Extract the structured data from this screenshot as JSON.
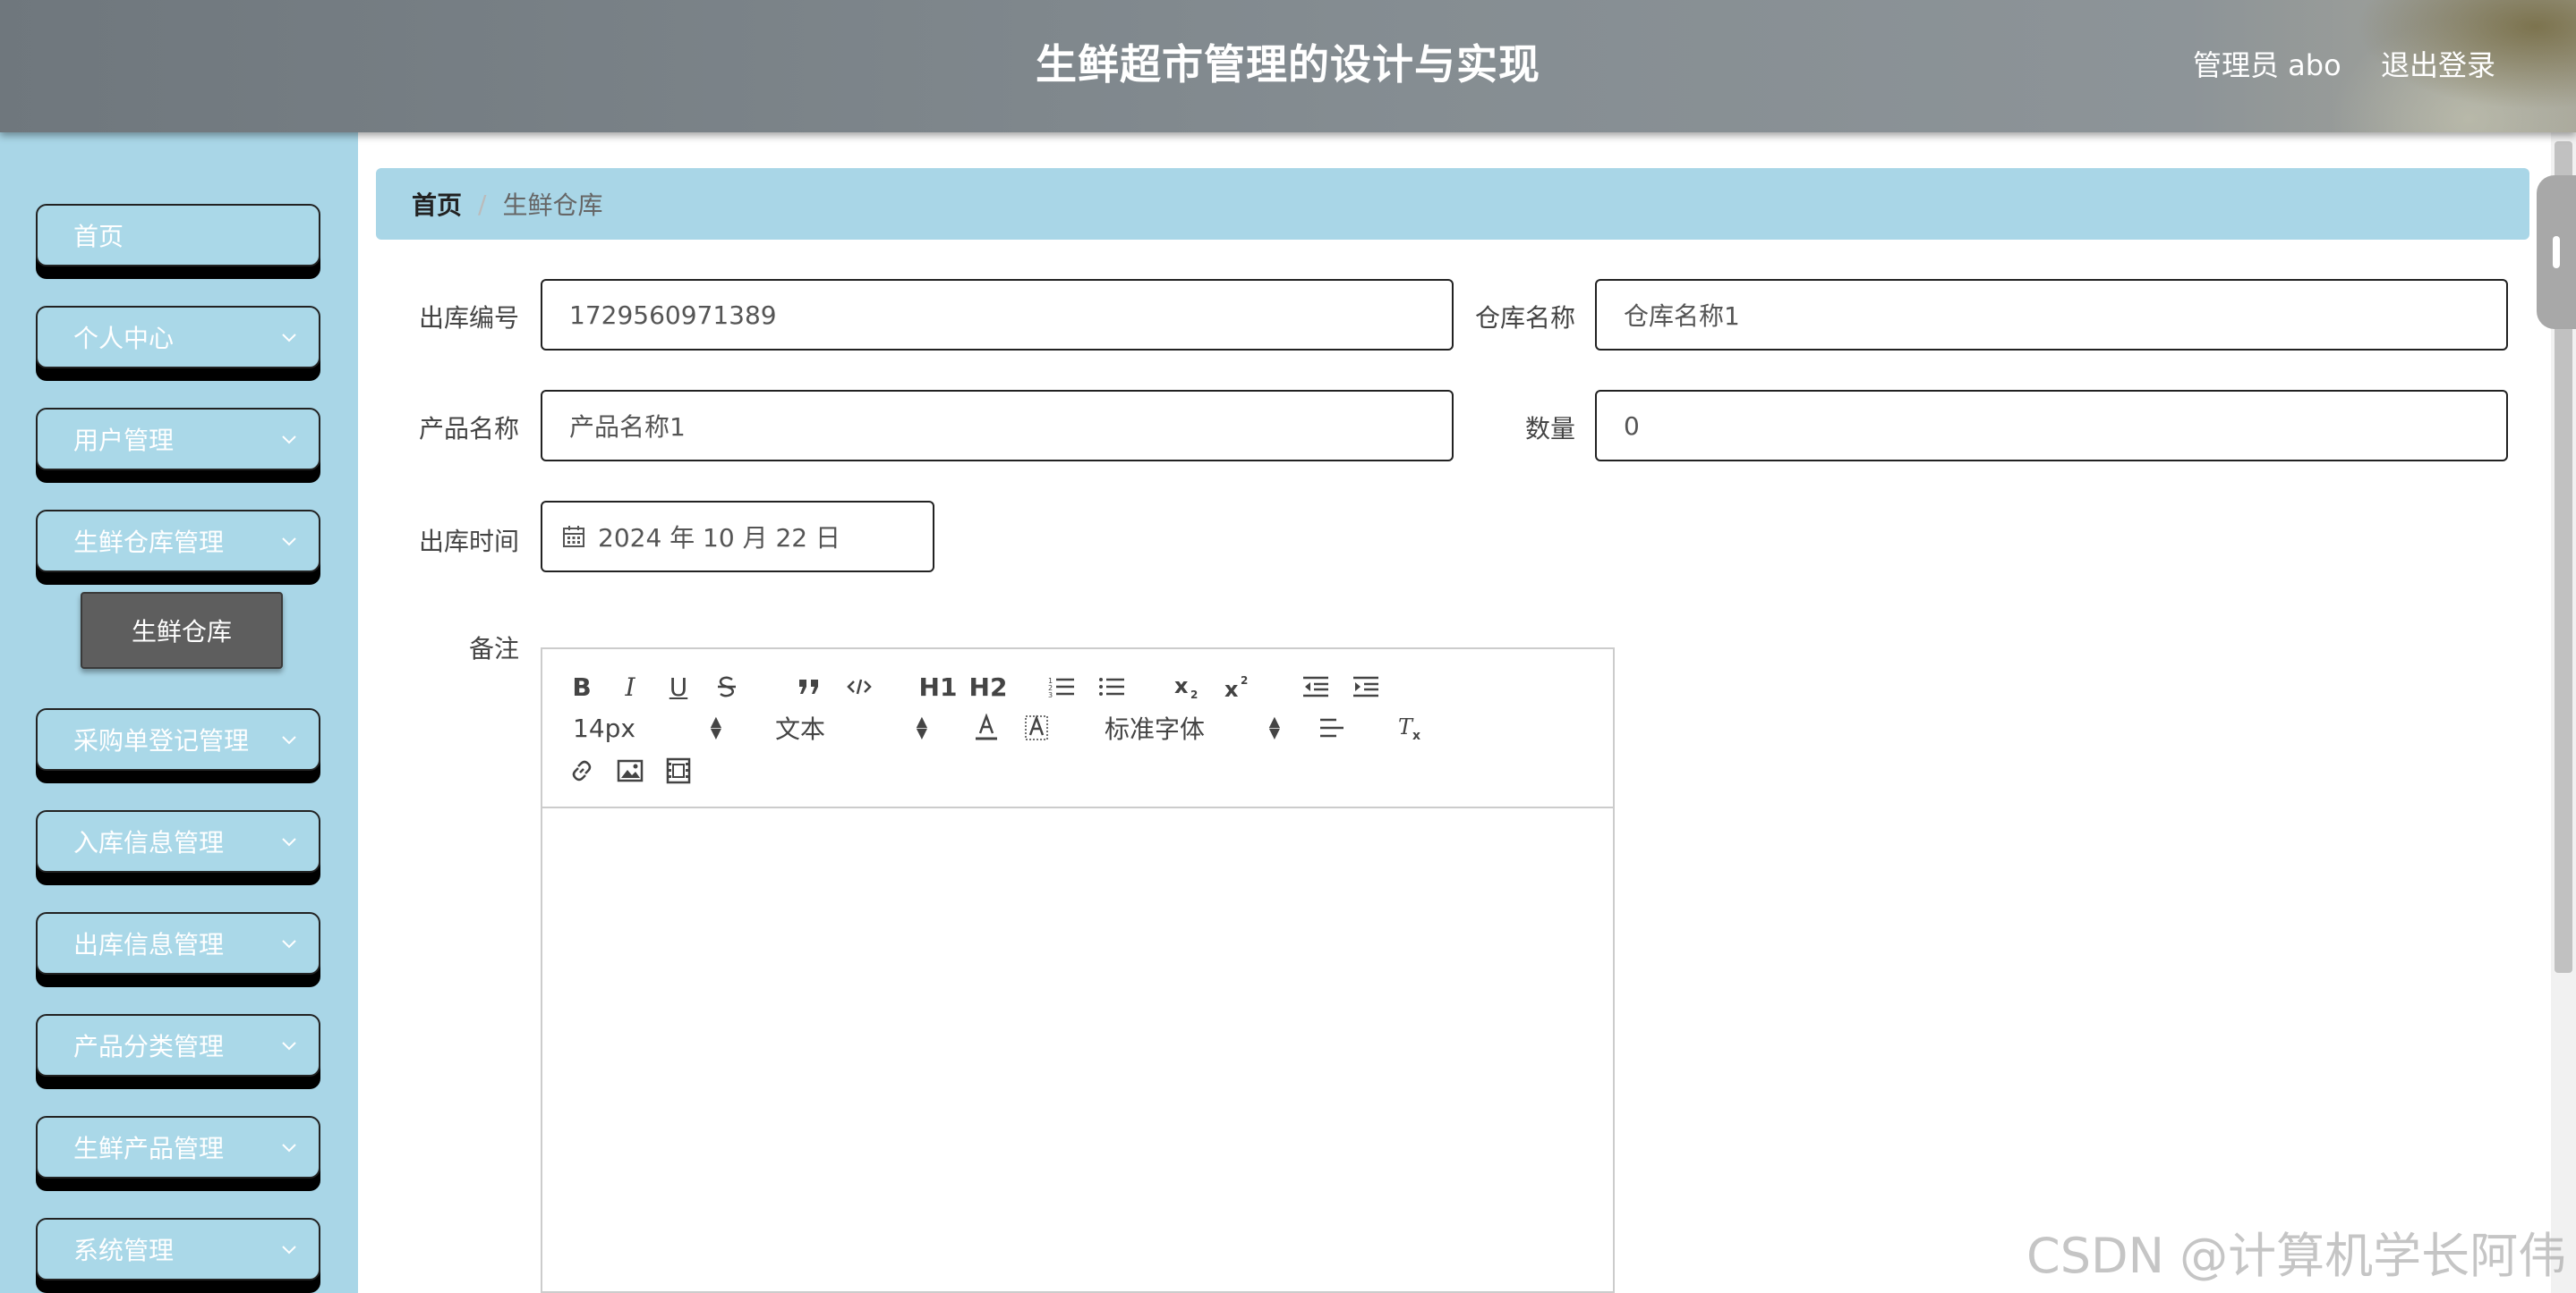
{
  "header": {
    "title": "生鲜超市管理的设计与实现",
    "user": "管理员 abo",
    "logout": "退出登录"
  },
  "sidebar": {
    "items": [
      {
        "label": "首页",
        "expandable": false
      },
      {
        "label": "个人中心",
        "expandable": true
      },
      {
        "label": "用户管理",
        "expandable": true
      },
      {
        "label": "生鲜仓库管理",
        "expandable": true
      },
      {
        "label": "采购单登记管理",
        "expandable": true
      },
      {
        "label": "入库信息管理",
        "expandable": true
      },
      {
        "label": "出库信息管理",
        "expandable": true
      },
      {
        "label": "产品分类管理",
        "expandable": true
      },
      {
        "label": "生鲜产品管理",
        "expandable": true
      },
      {
        "label": "系统管理",
        "expandable": true
      }
    ],
    "submenu": {
      "label": "生鲜仓库"
    }
  },
  "breadcrumb": {
    "home": "首页",
    "separator": "/",
    "current": "生鲜仓库"
  },
  "form": {
    "out_no": {
      "label": "出库编号",
      "value": "1729560971389"
    },
    "warehouse_name": {
      "label": "仓库名称",
      "value": "仓库名称1"
    },
    "product_name": {
      "label": "产品名称",
      "value": "产品名称1"
    },
    "quantity": {
      "label": "数量",
      "value": "0"
    },
    "out_time": {
      "label": "出库时间",
      "value": "2024 年 10 月 22 日"
    },
    "remark": {
      "label": "备注"
    }
  },
  "editor": {
    "font_size": "14px",
    "block_type": "文本",
    "font_family": "标准字体",
    "header1": "H1",
    "header2": "H2",
    "bold": "B",
    "italic": "I",
    "underline": "U"
  },
  "watermark": "CSDN @计算机学长阿伟",
  "colors": {
    "sidebar_bg": "#a9d6e7",
    "menu_bg": "#aad8e8",
    "submenu_active_bg": "#5e5e5e",
    "header_bg": "#858d92"
  }
}
